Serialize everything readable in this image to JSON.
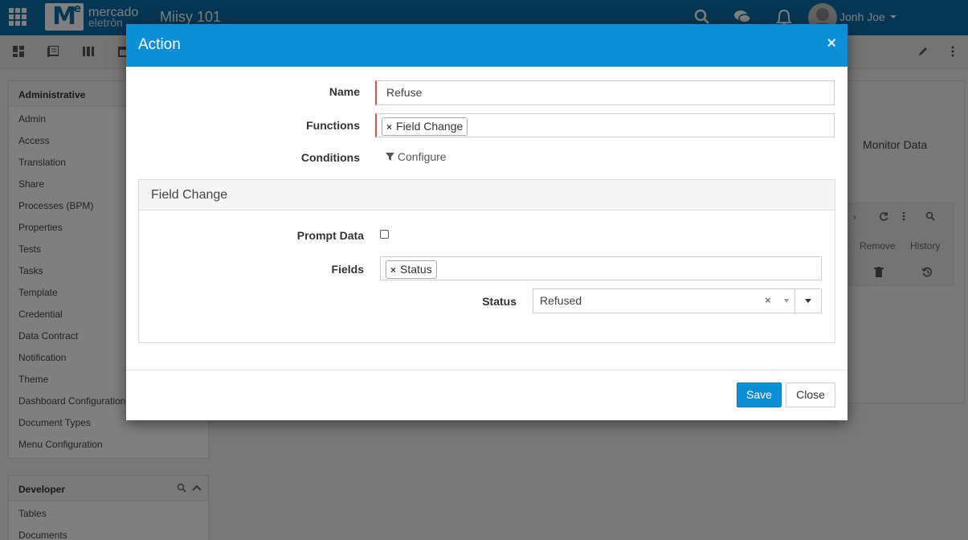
{
  "header": {
    "logo_letter": "M",
    "logo_sup": "e",
    "brand_line1": "mercado",
    "brand_line2": "eletrôn",
    "app_name": "Miisy 101",
    "user_name": "Jonh Joe",
    "icons": [
      "apps-icon",
      "search-icon",
      "chat-icon",
      "bell-icon",
      "avatar",
      "chevron-down-icon"
    ]
  },
  "toolbar": {
    "icons": [
      "dashboard-icon",
      "list-icon",
      "columns-icon",
      "calendar-icon",
      "pencil-icon",
      "more-vertical-icon"
    ]
  },
  "sidebar": {
    "admin_title": "Administrative",
    "admin_items": [
      "Admin",
      "Access",
      "Translation",
      "Share",
      "Processes (BPM)",
      "Properties",
      "Tests",
      "Tasks",
      "Template",
      "Credential",
      "Data Contract",
      "Notification",
      "Theme",
      "Dashboard Configuration",
      "Document Types",
      "Menu Configuration"
    ],
    "developer_title": "Developer",
    "developer_items": [
      "Tables",
      "Documents"
    ]
  },
  "background": {
    "monitor_data": "Monitor Data",
    "grid_columns": [
      "Remove",
      "History"
    ]
  },
  "modal": {
    "title": "Action",
    "close_symbol": "×",
    "name_label": "Name",
    "name_value": "Refuse",
    "functions_label": "Functions",
    "functions_tags": [
      "Field Change"
    ],
    "conditions_label": "Conditions",
    "configure_label": "Configure",
    "section_title": "Field Change",
    "prompt_label": "Prompt Data",
    "prompt_checked": false,
    "fields_label": "Fields",
    "fields_tags": [
      "Status"
    ],
    "status_label": "Status",
    "status_value": "Refused",
    "save_label": "Save",
    "close_label": "Close"
  }
}
